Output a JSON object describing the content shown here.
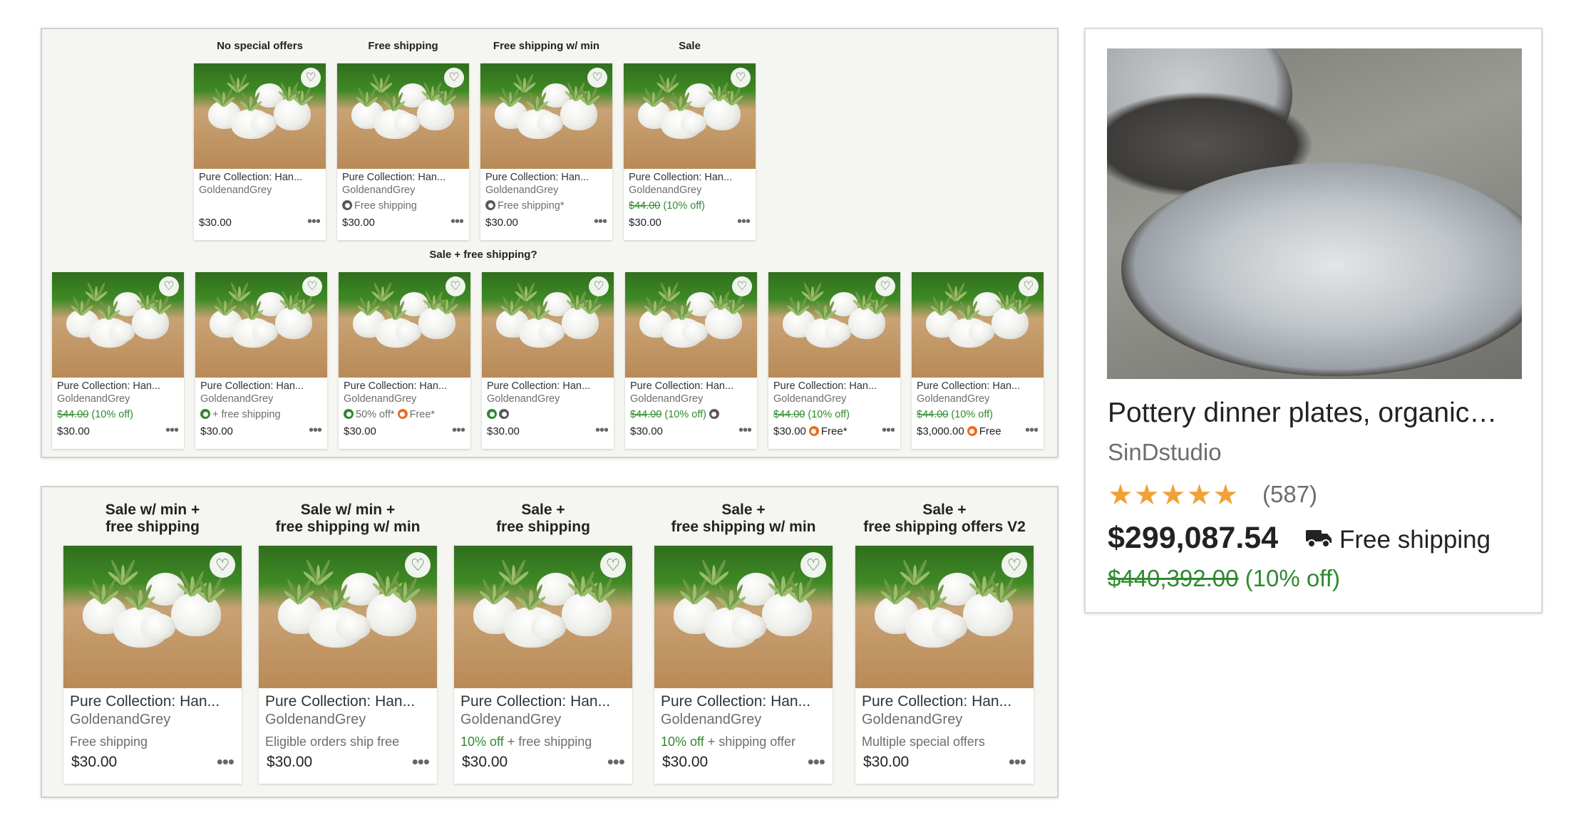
{
  "top_panel": {
    "row1_headers": [
      "No special offers",
      "Free shipping",
      "Free shipping w/ min",
      "Sale"
    ],
    "row2_header": "Sale + free shipping?",
    "row1_cards": [
      {
        "title": "Pure Collection: Han...",
        "shop": "GoldenandGrey",
        "price": "$30.00",
        "line": []
      },
      {
        "title": "Pure Collection: Han...",
        "shop": "GoldenandGrey",
        "price": "$30.00",
        "line": [
          {
            "badge": "gray"
          },
          {
            "text": "Free shipping",
            "style": "muted"
          }
        ]
      },
      {
        "title": "Pure Collection: Han...",
        "shop": "GoldenandGrey",
        "price": "$30.00",
        "line": [
          {
            "badge": "gray"
          },
          {
            "text": "Free shipping*",
            "style": "muted"
          }
        ]
      },
      {
        "title": "Pure Collection: Han...",
        "shop": "GoldenandGrey",
        "price": "$30.00",
        "line": [
          {
            "text": "$44.00",
            "style": "strike"
          },
          {
            "text": " (10% off)",
            "style": "green"
          }
        ]
      }
    ],
    "row2_cards": [
      {
        "title": "Pure Collection: Han...",
        "shop": "GoldenandGrey",
        "price": "$30.00",
        "price_extra": [],
        "line": [
          {
            "text": "$44.00",
            "style": "strike"
          },
          {
            "text": " (10% off)",
            "style": "green"
          }
        ]
      },
      {
        "title": "Pure Collection: Han...",
        "shop": "GoldenandGrey",
        "price": "$30.00",
        "price_extra": [],
        "line": [
          {
            "badge": "green"
          },
          {
            "text": "+ free shipping",
            "style": "muted"
          }
        ]
      },
      {
        "title": "Pure Collection: Han...",
        "shop": "GoldenandGrey",
        "price": "$30.00",
        "price_extra": [],
        "line": [
          {
            "badge": "green"
          },
          {
            "text": "50% off*",
            "style": "muted"
          },
          {
            "gap": true
          },
          {
            "badge": "orange"
          },
          {
            "text": "Free*",
            "style": "muted"
          }
        ]
      },
      {
        "title": "Pure Collection: Han...",
        "shop": "GoldenandGrey",
        "price": "$30.00",
        "price_extra": [],
        "line": [
          {
            "badge": "green"
          },
          {
            "badge": "gray"
          }
        ]
      },
      {
        "title": "Pure Collection: Han...",
        "shop": "GoldenandGrey",
        "price": "$30.00",
        "price_extra": [],
        "line": [
          {
            "text": "$44.00",
            "style": "strike"
          },
          {
            "text": " (10% off) ",
            "style": "green"
          },
          {
            "badge": "gray"
          }
        ]
      },
      {
        "title": "Pure Collection: Han...",
        "shop": "GoldenandGrey",
        "price": "$30.00",
        "price_extra": [
          {
            "badge": "orange"
          },
          {
            "text": "Free*",
            "style": "muted"
          }
        ],
        "line": [
          {
            "text": "$44.00",
            "style": "strike"
          },
          {
            "text": " (10% off)",
            "style": "green"
          }
        ]
      },
      {
        "title": "Pure Collection: Han...",
        "shop": "GoldenandGrey",
        "price": "$3,000.00",
        "price_extra": [
          {
            "badge": "orange"
          },
          {
            "text": "Free",
            "style": "muted"
          }
        ],
        "line": [
          {
            "text": "$44.00",
            "style": "strike"
          },
          {
            "text": " (10% off)",
            "style": "green"
          }
        ]
      }
    ]
  },
  "bottom_panel": {
    "headers": [
      [
        "Sale w/ min +",
        "free shipping"
      ],
      [
        "Sale w/ min +",
        "free shipping w/ min"
      ],
      [
        "Sale +",
        "free shipping"
      ],
      [
        "Sale +",
        "free shipping w/ min"
      ],
      [
        "Sale +",
        "free shipping offers V2"
      ]
    ],
    "cards": [
      {
        "title": "Pure Collection: Han...",
        "shop": "GoldenandGrey",
        "price": "$30.00",
        "line": [
          {
            "text": "Free shipping",
            "style": "muted"
          }
        ]
      },
      {
        "title": "Pure Collection: Han...",
        "shop": "GoldenandGrey",
        "price": "$30.00",
        "line": [
          {
            "text": "Eligible orders ship free",
            "style": "muted"
          }
        ]
      },
      {
        "title": "Pure Collection: Han...",
        "shop": "GoldenandGrey",
        "price": "$30.00",
        "line": [
          {
            "text": "10% off",
            "style": "green"
          },
          {
            "text": " + free shipping",
            "style": "muted"
          }
        ]
      },
      {
        "title": "Pure Collection: Han...",
        "shop": "GoldenandGrey",
        "price": "$30.00",
        "line": [
          {
            "text": "10% off",
            "style": "green"
          },
          {
            "text": " + shipping offer",
            "style": "muted"
          }
        ]
      },
      {
        "title": "Pure Collection: Han...",
        "shop": "GoldenandGrey",
        "price": "$30.00",
        "line": [
          {
            "text": "Multiple special offers",
            "style": "muted"
          }
        ]
      }
    ]
  },
  "card_icons": {
    "favorite": "heart-icon",
    "more": "more-options-icon",
    "more_glyph": "•••",
    "heart_glyph": "♡"
  },
  "feature_listing": {
    "title": "Pottery dinner plates, organic…",
    "shop": "SinDstudio",
    "stars": "★★★★★",
    "rating": 5,
    "review_count": "(587)",
    "price": "$299,087.54",
    "shipping": "Free shipping",
    "original_price": "$440,392.00",
    "discount": " (10% off)"
  },
  "colors": {
    "sale_green": "#2f8a2f",
    "star_orange": "#f1a137",
    "promo_orange": "#eb6d20",
    "badge_gray": "#595959",
    "panel_bg": "#f5f5f1"
  }
}
